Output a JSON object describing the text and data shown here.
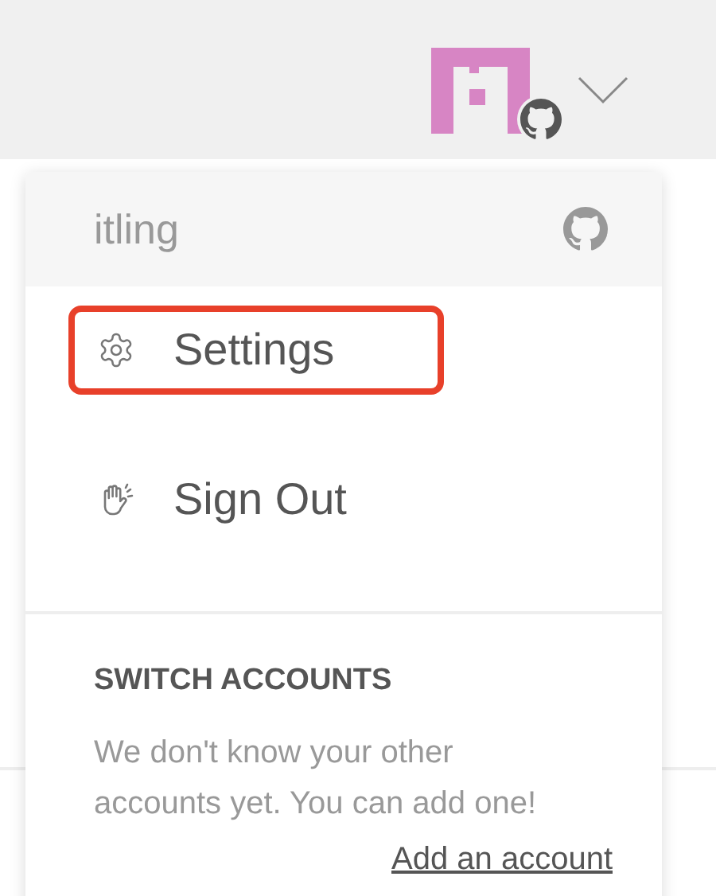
{
  "account_menu": {
    "username": "itling",
    "items": [
      {
        "kind": "settings",
        "label": "Settings",
        "highlighted": true
      },
      {
        "kind": "sign-out",
        "label": "Sign Out",
        "highlighted": false
      }
    ],
    "switch_accounts": {
      "heading": "SWITCH ACCOUNTS",
      "message": "We don't know your other accounts yet. You can add one!",
      "link": "Add an account"
    }
  }
}
